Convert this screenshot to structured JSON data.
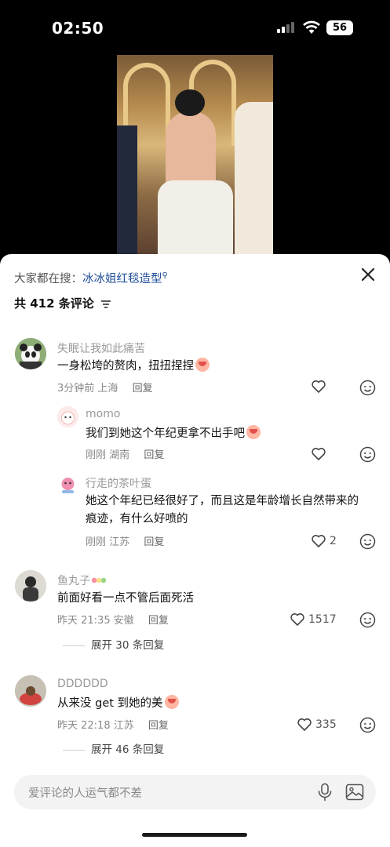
{
  "status_bar": {
    "time": "02:50",
    "battery": "56"
  },
  "search": {
    "prefix": "大家都在搜：",
    "term": "冰冰姐红毯造型"
  },
  "comments_header": {
    "count_label": "共 412 条评论"
  },
  "comments": [
    {
      "user": "失眠让我如此痛苦",
      "text": "一身松垮的赘肉，扭扭捏捏",
      "time": "3分钟前",
      "location": "上海",
      "reply": "回复",
      "likes": ""
    },
    {
      "user": "momo",
      "text": "我们到她这个年纪更拿不出手吧",
      "time": "刚刚",
      "location": "湖南",
      "reply": "回复",
      "likes": ""
    },
    {
      "user": "行走的茶叶蛋",
      "text": "她这个年纪已经很好了，而且这是年龄增长自然带来的痕迹，有什么好喷的",
      "time": "刚刚",
      "location": "江苏",
      "reply": "回复",
      "likes": "2"
    },
    {
      "user": "鱼丸子",
      "text": "前面好看一点不管后面死活",
      "time": "昨天 21:35",
      "location": "安徽",
      "reply": "回复",
      "likes": "1517",
      "expand": "展开 30 条回复"
    },
    {
      "user": "DDDDDD",
      "text": "从来没 get 到她的美",
      "time": "昨天 22:18",
      "location": "江苏",
      "reply": "回复",
      "likes": "335",
      "expand": "展开 46 条回复"
    }
  ],
  "input": {
    "placeholder": "爱评论的人运气都不差"
  },
  "icons": [
    "signal-icon",
    "wifi-icon",
    "close-icon",
    "filter-icon",
    "heart-icon",
    "emoji-icon",
    "mic-icon",
    "image-icon"
  ],
  "colors": {
    "link": "#1f4e99",
    "text": "#111111",
    "meta": "#888888"
  }
}
